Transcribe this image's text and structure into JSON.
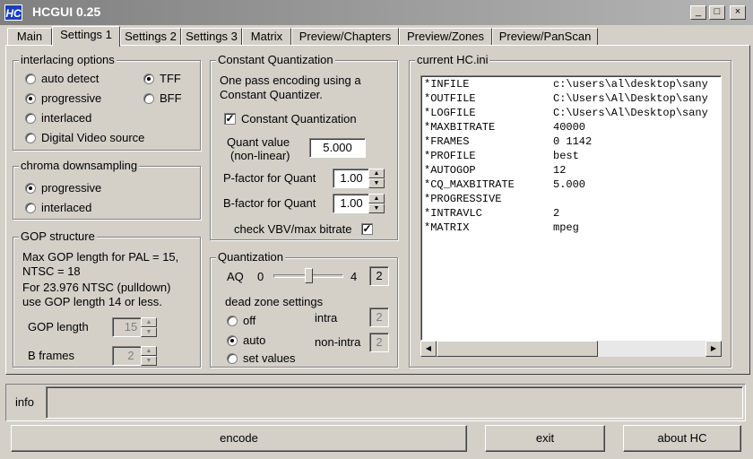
{
  "window": {
    "icon_text": "HC",
    "title": "HCGUI 0.25",
    "minimize": "_",
    "maximize": "□",
    "close": "×"
  },
  "tabs": [
    "Main",
    "Settings 1",
    "Settings 2",
    "Settings 3",
    "Matrix",
    "Preview/Chapters",
    "Preview/Zones",
    "Preview/PanScan"
  ],
  "active_tab": "Settings 1",
  "interlacing": {
    "title": "interlacing options",
    "options": [
      "auto detect",
      "progressive",
      "interlaced",
      "Digital Video source"
    ],
    "selected": "progressive",
    "field_order": [
      "TFF",
      "BFF"
    ],
    "field_order_selected": "TFF"
  },
  "chroma": {
    "title": "chroma downsampling",
    "options": [
      "progressive",
      "interlaced"
    ],
    "selected": "progressive"
  },
  "gop": {
    "title": "GOP structure",
    "note1": "Max GOP length for PAL = 15,",
    "note2": "NTSC = 18",
    "note3": "For 23.976 NTSC (pulldown)",
    "note4": "use GOP length 14 or less.",
    "gop_length_label": "GOP length",
    "gop_length_value": "15",
    "bframes_label": "B frames",
    "bframes_value": "2"
  },
  "cq": {
    "title": "Constant Quantization",
    "desc1": "One pass encoding using a",
    "desc2": "Constant Quantizer.",
    "checkbox_label": "Constant Quantization",
    "checked": true,
    "quant_label1": "Quant value",
    "quant_label2": "(non-linear)",
    "quant_value": "5.000",
    "pfactor_label": "P-factor for Quant",
    "pfactor_value": "1.00",
    "bfactor_label": "B-factor for Quant",
    "bfactor_value": "1.00",
    "vbv_label": "check VBV/max bitrate",
    "vbv_checked": true
  },
  "quantization": {
    "title": "Quantization",
    "aq_label": "AQ",
    "aq_min": "0",
    "aq_max": "4",
    "aq_value": "2",
    "aq_level": 0.5,
    "deadzone_label": "dead zone settings",
    "options": [
      "off",
      "auto",
      "set values"
    ],
    "selected": "auto",
    "intra_label": "intra",
    "intra_value": "2",
    "nonintra_label": "non-intra",
    "nonintra_value": "2"
  },
  "ini": {
    "title": "current HC.ini",
    "lines": [
      {
        "key": "*INFILE",
        "value": "c:\\users\\al\\desktop\\sany"
      },
      {
        "key": "*OUTFILE",
        "value": "C:\\Users\\Al\\Desktop\\sany"
      },
      {
        "key": "*LOGFILE",
        "value": "C:\\Users\\Al\\Desktop\\sany"
      },
      {
        "key": "*MAXBITRATE",
        "value": "40000"
      },
      {
        "key": "*FRAMES",
        "value": "0 1142"
      },
      {
        "key": "*PROFILE",
        "value": "best"
      },
      {
        "key": "*AUTOGOP",
        "value": "12"
      },
      {
        "key": "*CQ_MAXBITRATE",
        "value": "5.000"
      },
      {
        "key": "*PROGRESSIVE",
        "value": ""
      },
      {
        "key": "*INTRAVLC",
        "value": "2"
      },
      {
        "key": "*MATRIX",
        "value": "mpeg"
      }
    ]
  },
  "info": {
    "label": "info",
    "text": ""
  },
  "buttons": {
    "encode": "encode",
    "exit": "exit",
    "about": "about HC"
  }
}
